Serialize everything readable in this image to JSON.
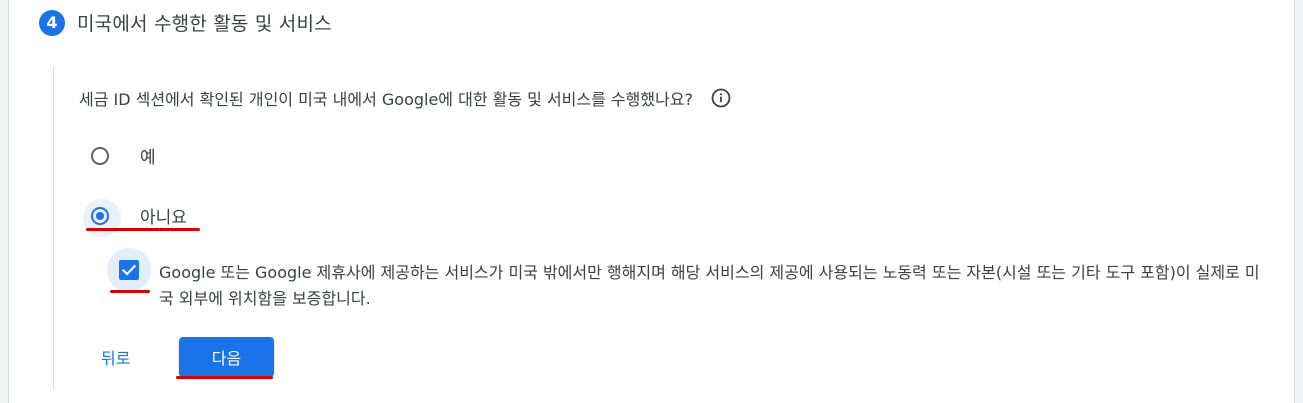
{
  "step": {
    "number": "4",
    "title": "미국에서 수행한 활동 및 서비스"
  },
  "question": {
    "text": "세금 ID 섹션에서 확인된 개인이 미국 내에서 Google에 대한 활동 및 서비스를 수행했나요?",
    "info_icon": "info-circle-icon"
  },
  "options": [
    {
      "label": "예",
      "selected": false
    },
    {
      "label": "아니요",
      "selected": true
    }
  ],
  "certification": {
    "checked": true,
    "text": "Google 또는 Google 제휴사에 제공하는 서비스가 미국 밖에서만 행해지며 해당 서비스의 제공에 사용되는 노동력 또는 자본(시설 또는 기타 도구 포함)이 실제로 미국 외부에 위치함을 보증합니다."
  },
  "buttons": {
    "back_label": "뒤로",
    "next_label": "다음"
  },
  "colors": {
    "accent": "#1a73e8",
    "annotation": "#d50000"
  }
}
